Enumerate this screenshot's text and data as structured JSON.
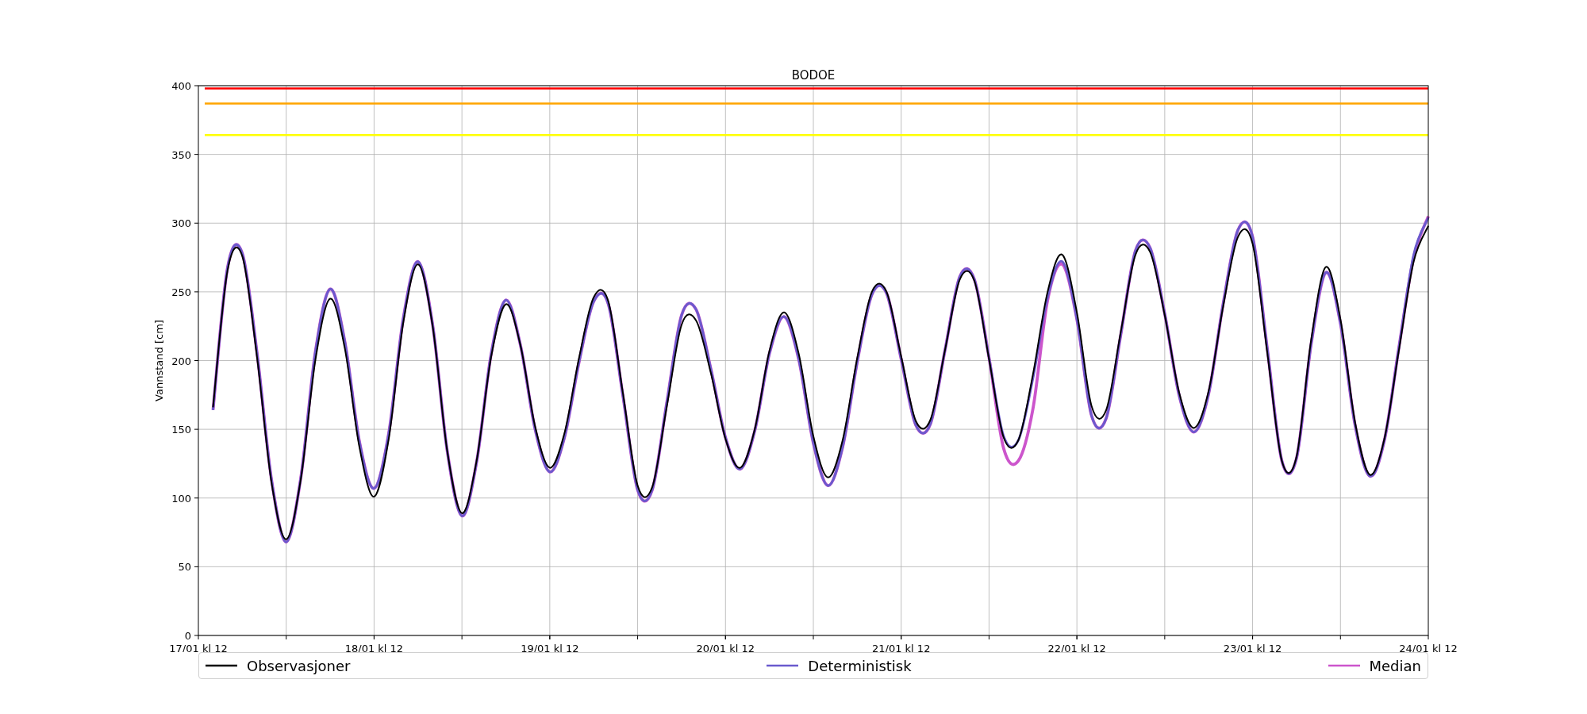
{
  "chart": {
    "chart_data": {
      "type": "line",
      "title": "BODOE",
      "ylabel": "Vannstand [cm]",
      "ylim": [
        0,
        400
      ],
      "yticks": [
        0,
        50,
        100,
        150,
        200,
        250,
        300,
        350,
        400
      ],
      "categories": [
        "17/01 kl 12",
        null,
        null,
        null,
        null,
        null,
        null,
        null,
        null,
        null,
        null,
        null,
        "18/01 kl 12",
        null,
        null,
        null,
        null,
        null,
        null,
        null,
        null,
        null,
        null,
        null,
        "19/01 kl 12",
        null,
        null,
        null,
        null,
        null,
        null,
        null,
        null,
        null,
        null,
        null,
        "20/01 kl 12",
        null,
        null,
        null,
        null,
        null,
        null,
        null,
        null,
        null,
        null,
        null,
        "21/01 kl 12",
        null,
        null,
        null,
        null,
        null,
        null,
        null,
        null,
        null,
        null,
        null,
        "22/01 kl 12",
        null,
        null,
        null,
        null,
        null,
        null,
        null,
        null,
        null,
        null,
        null,
        "23/01 kl 12",
        null,
        null,
        null,
        null,
        null,
        null,
        null,
        null,
        null,
        null,
        null,
        "24/01 kl 12"
      ],
      "series": [
        {
          "name": "Observasjoner",
          "color": "#000000",
          "values": [
            null,
            166,
            266,
            276,
            203,
            111,
            70,
            114,
            201,
            245,
            209,
            137,
            101,
            143,
            228,
            270,
            225,
            134,
            89,
            127,
            203,
            241,
            211,
            152,
            122,
            147,
            202,
            246,
            243,
            176,
            109,
            108,
            167,
            226,
            229,
            191,
            143,
            122,
            150,
            207,
            235,
            205,
            145,
            115,
            142,
            202,
            250,
            250,
            203,
            156,
            157,
            208,
            259,
            258,
            201,
            144,
            142,
            190,
            250,
            277,
            235,
            167,
            164,
            221,
            277,
            279,
            233,
            176,
            151,
            178,
            240,
            290,
            285,
            206,
            127,
            130,
            215,
            268,
            230,
            155,
            117,
            143,
            208,
            272,
            298
          ]
        },
        {
          "name": "Deterministisk",
          "color": "#6a5acd",
          "values": [
            null,
            164,
            268,
            278,
            206,
            113,
            68,
            115,
            207,
            252,
            214,
            141,
            107,
            147,
            231,
            272,
            226,
            134,
            87,
            126,
            205,
            244,
            211,
            150,
            119,
            144,
            199,
            243,
            241,
            174,
            106,
            106,
            170,
            233,
            237,
            194,
            144,
            121,
            149,
            205,
            232,
            201,
            140,
            109,
            137,
            199,
            248,
            249,
            201,
            153,
            154,
            208,
            261,
            259,
            202,
            145,
            142,
            187,
            246,
            272,
            230,
            160,
            158,
            219,
            280,
            282,
            234,
            174,
            148,
            176,
            242,
            295,
            290,
            209,
            127,
            129,
            212,
            264,
            227,
            153,
            116,
            142,
            210,
            277,
            304
          ]
        },
        {
          "name": "Median",
          "color": "#cc55cc",
          "values": [
            null,
            164,
            268,
            278,
            206,
            113,
            68,
            115,
            207,
            252,
            214,
            141,
            107,
            147,
            231,
            272,
            226,
            134,
            87,
            126,
            205,
            244,
            211,
            150,
            119,
            144,
            199,
            243,
            241,
            174,
            106,
            106,
            170,
            233,
            237,
            194,
            144,
            121,
            149,
            205,
            232,
            201,
            140,
            109,
            137,
            199,
            248,
            249,
            201,
            153,
            154,
            208,
            261,
            259,
            202,
            136,
            127,
            165,
            244,
            270,
            230,
            160,
            158,
            219,
            280,
            282,
            234,
            174,
            148,
            176,
            242,
            295,
            290,
            209,
            127,
            129,
            212,
            264,
            227,
            153,
            116,
            142,
            210,
            275,
            305
          ]
        }
      ],
      "grid": true,
      "legend": true,
      "ref_lines": [
        {
          "axis": "y",
          "value": 398,
          "color": "#ff0000"
        },
        {
          "axis": "y",
          "value": 387,
          "color": "#ffa500"
        },
        {
          "axis": "y",
          "value": 364,
          "color": "#ffff00"
        }
      ]
    }
  }
}
